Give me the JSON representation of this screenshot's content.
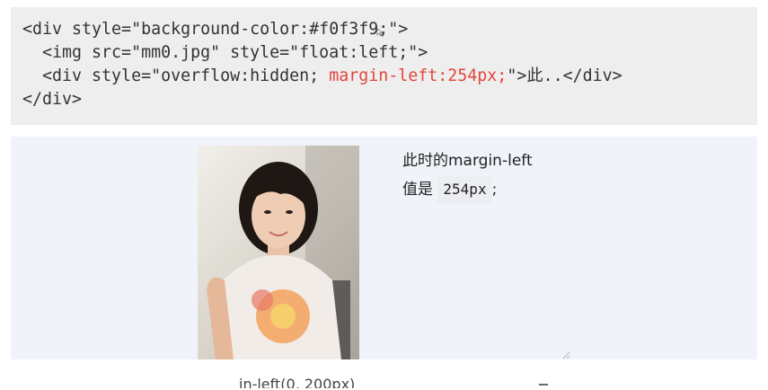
{
  "code": {
    "line1": "<div style=\"background-color:#f0f3f9;\">",
    "line2": "  <img src=\"mm0.jpg\" style=\"float:left;\">",
    "line3_before": "  <div style=\"overflow:hidden; ",
    "line3_highlight": "margin-left:254px;",
    "line3_after": "\">此..</div>",
    "line4": "</div>",
    "highlight_color": "#e2463c"
  },
  "demo": {
    "line1": "此时的margin-left",
    "line2_prefix": "值是",
    "line2_code": "254px",
    "line2_suffix": ";",
    "background": "#f0f3f9"
  },
  "bottom": {
    "fragment": "in-left(0, 200px)"
  },
  "icons": {
    "cursor": "mouse-cursor-icon",
    "resize": "resize-handle-icon"
  }
}
